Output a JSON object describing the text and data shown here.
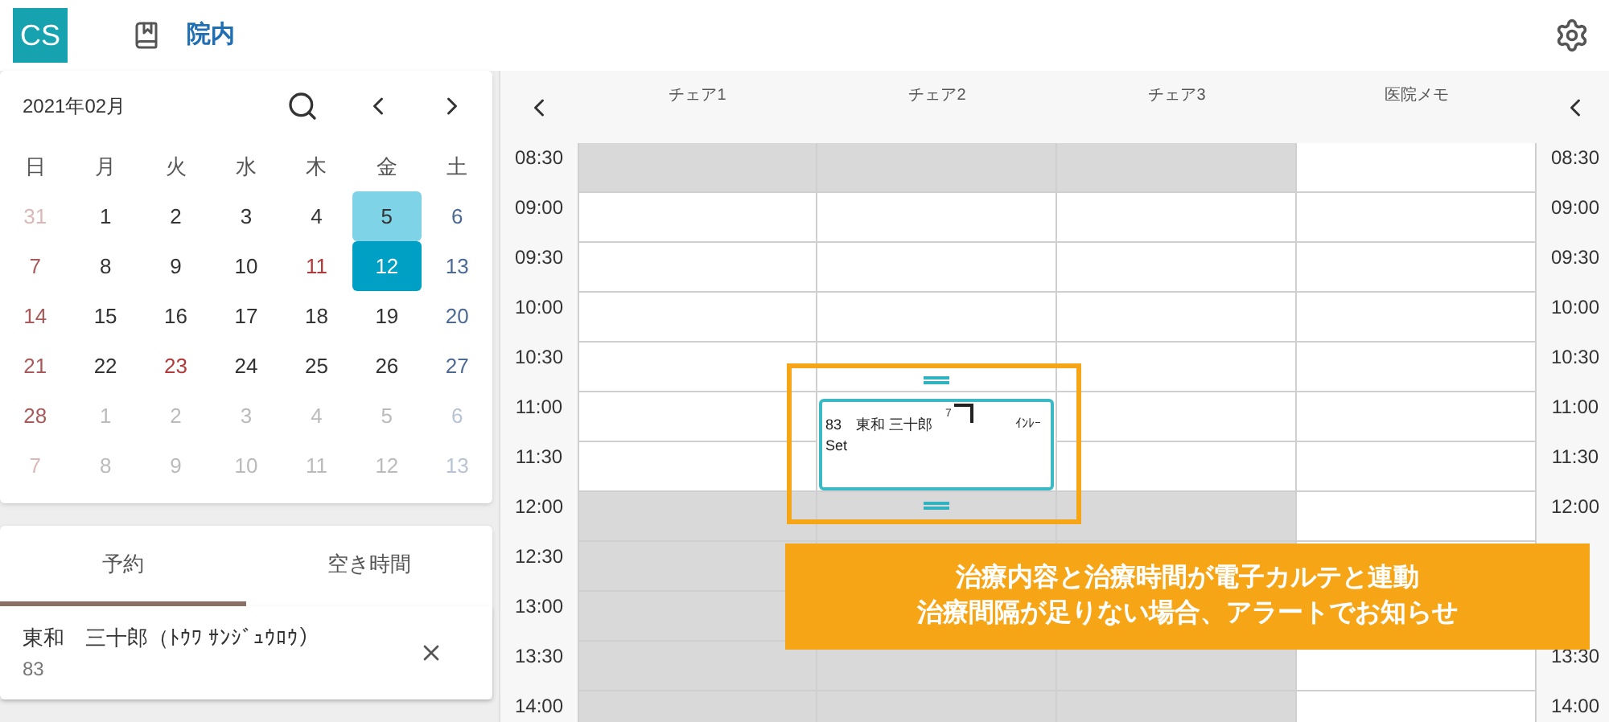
{
  "header": {
    "logo": "CS",
    "title": "院内"
  },
  "calendar": {
    "month": "2021年02月",
    "weekdays": [
      "日",
      "月",
      "火",
      "水",
      "木",
      "金",
      "土"
    ],
    "weeks": [
      [
        {
          "day": "31",
          "kind": "other",
          "selected": false,
          "today": false
        },
        {
          "day": "1",
          "kind": "normal",
          "selected": false,
          "today": false
        },
        {
          "day": "2",
          "kind": "normal",
          "selected": false,
          "today": false
        },
        {
          "day": "3",
          "kind": "normal",
          "selected": false,
          "today": false
        },
        {
          "day": "4",
          "kind": "normal",
          "selected": false,
          "today": false
        },
        {
          "day": "5",
          "kind": "normal",
          "selected": false,
          "today": true
        },
        {
          "day": "6",
          "kind": "saturday",
          "selected": false,
          "today": false
        }
      ],
      [
        {
          "day": "7",
          "kind": "sunday",
          "selected": false,
          "today": false
        },
        {
          "day": "8",
          "kind": "normal",
          "selected": false,
          "today": false
        },
        {
          "day": "9",
          "kind": "normal",
          "selected": false,
          "today": false
        },
        {
          "day": "10",
          "kind": "normal",
          "selected": false,
          "today": false
        },
        {
          "day": "11",
          "kind": "holiday",
          "selected": false,
          "today": false
        },
        {
          "day": "12",
          "kind": "normal",
          "selected": true,
          "today": false
        },
        {
          "day": "13",
          "kind": "saturday",
          "selected": false,
          "today": false
        }
      ],
      [
        {
          "day": "14",
          "kind": "sunday",
          "selected": false,
          "today": false
        },
        {
          "day": "15",
          "kind": "normal",
          "selected": false,
          "today": false
        },
        {
          "day": "16",
          "kind": "normal",
          "selected": false,
          "today": false
        },
        {
          "day": "17",
          "kind": "normal",
          "selected": false,
          "today": false
        },
        {
          "day": "18",
          "kind": "normal",
          "selected": false,
          "today": false
        },
        {
          "day": "19",
          "kind": "normal",
          "selected": false,
          "today": false
        },
        {
          "day": "20",
          "kind": "saturday",
          "selected": false,
          "today": false
        }
      ],
      [
        {
          "day": "21",
          "kind": "sunday",
          "selected": false,
          "today": false
        },
        {
          "day": "22",
          "kind": "normal",
          "selected": false,
          "today": false
        },
        {
          "day": "23",
          "kind": "holiday",
          "selected": false,
          "today": false
        },
        {
          "day": "24",
          "kind": "normal",
          "selected": false,
          "today": false
        },
        {
          "day": "25",
          "kind": "normal",
          "selected": false,
          "today": false
        },
        {
          "day": "26",
          "kind": "normal",
          "selected": false,
          "today": false
        },
        {
          "day": "27",
          "kind": "saturday",
          "selected": false,
          "today": false
        }
      ],
      [
        {
          "day": "28",
          "kind": "sunday",
          "selected": false,
          "today": false
        },
        {
          "day": "1",
          "kind": "other",
          "selected": false,
          "today": false
        },
        {
          "day": "2",
          "kind": "other",
          "selected": false,
          "today": false
        },
        {
          "day": "3",
          "kind": "other",
          "selected": false,
          "today": false
        },
        {
          "day": "4",
          "kind": "other",
          "selected": false,
          "today": false
        },
        {
          "day": "5",
          "kind": "other",
          "selected": false,
          "today": false
        },
        {
          "day": "6",
          "kind": "other",
          "selected": false,
          "today": false
        }
      ],
      [
        {
          "day": "7",
          "kind": "other",
          "selected": false,
          "today": false
        },
        {
          "day": "8",
          "kind": "other",
          "selected": false,
          "today": false
        },
        {
          "day": "9",
          "kind": "other",
          "selected": false,
          "today": false
        },
        {
          "day": "10",
          "kind": "other",
          "selected": false,
          "today": false
        },
        {
          "day": "11",
          "kind": "other",
          "selected": false,
          "today": false
        },
        {
          "day": "12",
          "kind": "other",
          "selected": false,
          "today": false
        },
        {
          "day": "13",
          "kind": "other",
          "selected": false,
          "today": false
        }
      ]
    ]
  },
  "tabs": [
    {
      "label": "予約",
      "selected": true
    },
    {
      "label": "空き時間",
      "selected": false
    }
  ],
  "reservations": [
    {
      "name": "東和　三十郎（ﾄｳﾜ ｻﾝｼﾞｭｳﾛｳ）",
      "number": "83"
    }
  ],
  "schedule": {
    "columns": [
      "チェア1",
      "チェア2",
      "チェア3",
      "医院メモ"
    ],
    "rows": [
      {
        "time": "08:30",
        "right_time": "08:30",
        "cells": [
          {
            "closed": true
          },
          {
            "closed": true
          },
          {
            "closed": true
          },
          {
            "closed": false
          }
        ]
      },
      {
        "time": "09:00",
        "right_time": "09:00",
        "cells": [
          {
            "closed": false
          },
          {
            "closed": false
          },
          {
            "closed": false
          },
          {
            "closed": false
          }
        ]
      },
      {
        "time": "09:30",
        "right_time": "09:30",
        "cells": [
          {
            "closed": false
          },
          {
            "closed": false
          },
          {
            "closed": false
          },
          {
            "closed": false
          }
        ]
      },
      {
        "time": "10:00",
        "right_time": "10:00",
        "cells": [
          {
            "closed": false
          },
          {
            "closed": false
          },
          {
            "closed": false
          },
          {
            "closed": false
          }
        ]
      },
      {
        "time": "10:30",
        "right_time": "10:30",
        "cells": [
          {
            "closed": false
          },
          {
            "closed": false
          },
          {
            "closed": false
          },
          {
            "closed": false
          }
        ]
      },
      {
        "time": "11:00",
        "right_time": "11:00",
        "cells": [
          {
            "closed": false
          },
          {
            "closed": false,
            "appointment": {
              "number": "83",
              "name": "東和 三十郎",
              "mark": "7",
              "tag": "ｲﾝﾚｰ",
              "note": "Set"
            }
          },
          {
            "closed": false
          },
          {
            "closed": false
          }
        ]
      },
      {
        "time": "11:30",
        "right_time": "11:30",
        "cells": [
          {
            "closed": false
          },
          {
            "closed": false
          },
          {
            "closed": false
          },
          {
            "closed": false
          }
        ]
      },
      {
        "time": "12:00",
        "right_time": "12:00",
        "cells": [
          {
            "closed": true
          },
          {
            "closed": true
          },
          {
            "closed": true
          },
          {
            "closed": false
          }
        ]
      },
      {
        "time": "12:30",
        "cells": [
          {
            "closed": true
          },
          {
            "closed": true
          },
          {
            "closed": true
          },
          {
            "closed": false
          }
        ]
      },
      {
        "time": "13:00",
        "cells": [
          {
            "closed": true
          },
          null,
          null,
          null
        ]
      },
      {
        "time": "13:30",
        "right_time": "13:30",
        "cells": [
          {
            "closed": true
          },
          {
            "closed": true
          },
          {
            "closed": true
          },
          {
            "closed": false
          }
        ]
      },
      {
        "time": "14:00",
        "right_time": "14:00",
        "cells": [
          {
            "closed": true
          },
          {
            "closed": true
          },
          {
            "closed": true
          },
          {
            "closed": false
          }
        ]
      }
    ]
  },
  "callout": {
    "lines": [
      "治療内容と治療時間が電子カルテと連動",
      "治療間隔が足りない場合、アラートでお知らせ"
    ]
  }
}
